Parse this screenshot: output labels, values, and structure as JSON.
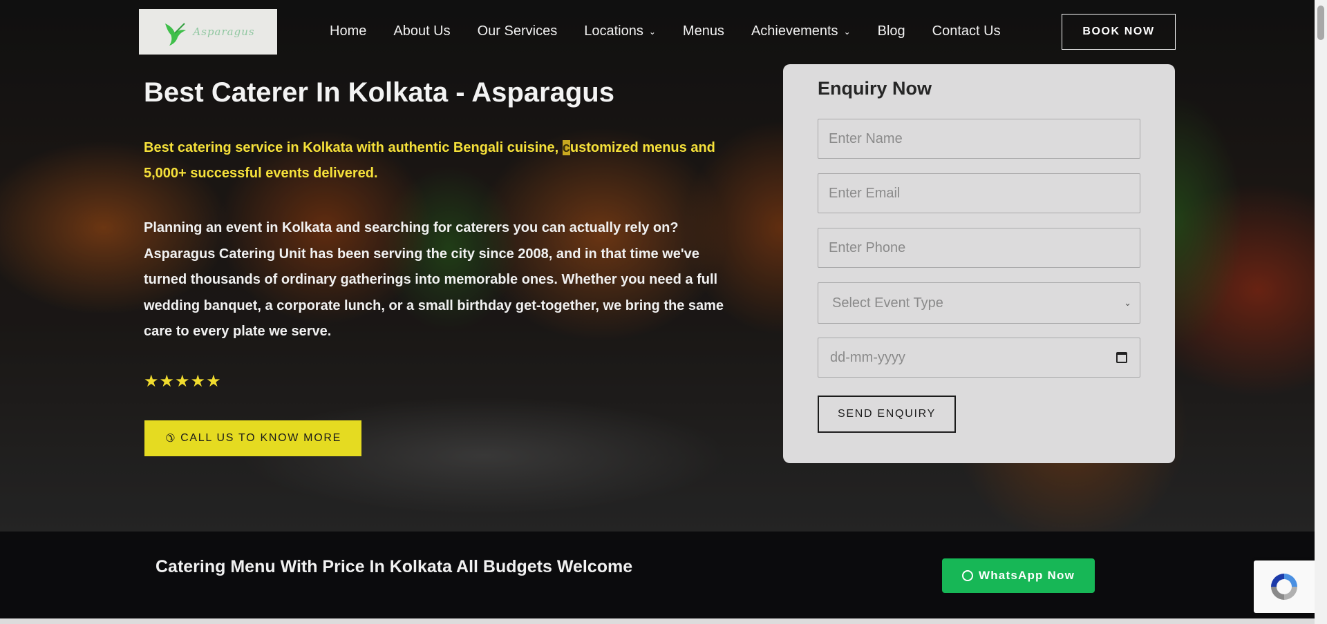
{
  "logo": {
    "text": "Asparagus",
    "alt": "Asparagus logo"
  },
  "nav": {
    "items": [
      {
        "label": "Home",
        "dropdown": false
      },
      {
        "label": "About Us",
        "dropdown": false
      },
      {
        "label": "Our Services",
        "dropdown": false
      },
      {
        "label": "Locations",
        "dropdown": true
      },
      {
        "label": "Menus",
        "dropdown": false
      },
      {
        "label": "Achievements",
        "dropdown": true
      },
      {
        "label": "Blog",
        "dropdown": false
      },
      {
        "label": "Contact Us",
        "dropdown": false
      }
    ],
    "book_label": "BOOK NOW"
  },
  "hero": {
    "title": "Best Caterer In Kolkata - Asparagus",
    "tagline_before": "Best catering service in Kolkata with authentic Bengali cuisine, ",
    "tagline_mark": "c",
    "tagline_after": "ustomized menus and 5,000+ successful events delivered.",
    "body": "Planning an event in Kolkata and searching for caterers you can actually rely on? Asparagus Catering Unit has been serving the city since 2008, and in that time we've turned thousands of ordinary gatherings into memorable ones. Whether you need a full wedding banquet, a corporate lunch, or a small birthday get-together, we bring the same care to every plate we serve.",
    "rating": {
      "value": 5,
      "max": 5,
      "star_glyph": "★"
    },
    "call_label": "CALL US TO KNOW MORE",
    "call_icon": "phone-icon"
  },
  "enquiry": {
    "title": "Enquiry Now",
    "name_placeholder": "Enter Name",
    "email_placeholder": "Enter Email",
    "phone_placeholder": "Enter Phone",
    "event_type_selected": "Select Event Type",
    "date_placeholder": "dd-mm-yyyy",
    "send_label": "SEND ENQUIRY"
  },
  "strip": {
    "title": "Catering Menu With Price In Kolkata All Budgets Welcome",
    "whatsapp_label": "WhatsApp Now",
    "whatsapp_icon": "whatsapp-icon"
  },
  "colors": {
    "accent_yellow": "#e5db21",
    "tagline_yellow": "#f6e13a",
    "whatsapp_green": "#17b756",
    "card_bg": "#dcdbdc"
  }
}
